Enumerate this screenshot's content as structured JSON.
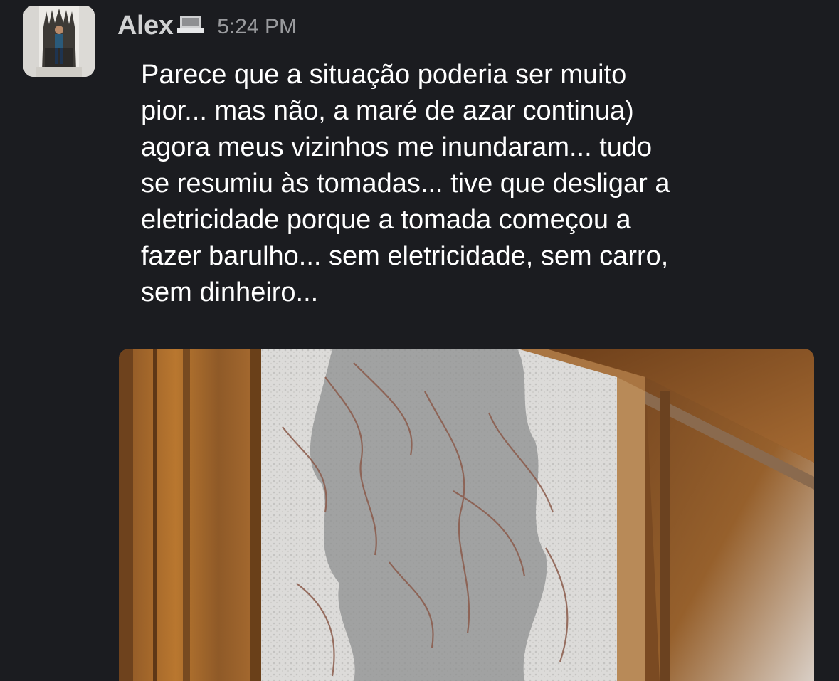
{
  "message": {
    "author": "Alex",
    "timestamp": "5:24 PM",
    "status_icon": "laptop-icon",
    "body": "Parece que a situação poderia ser muito\npior... mas não, a maré de azar continua)\nagora meus vizinhos me inundaram... tudo\nse resumiu às tomadas... tive que desligar a\neletricidade porque a tomada começou a\nfazer barulho... sem eletricidade, sem carro,\nsem dinheiro..."
  },
  "colors": {
    "background": "#1b1c20",
    "author": "#d1d2d3",
    "timestamp": "#9a9b9e",
    "text": "#ffffff"
  }
}
